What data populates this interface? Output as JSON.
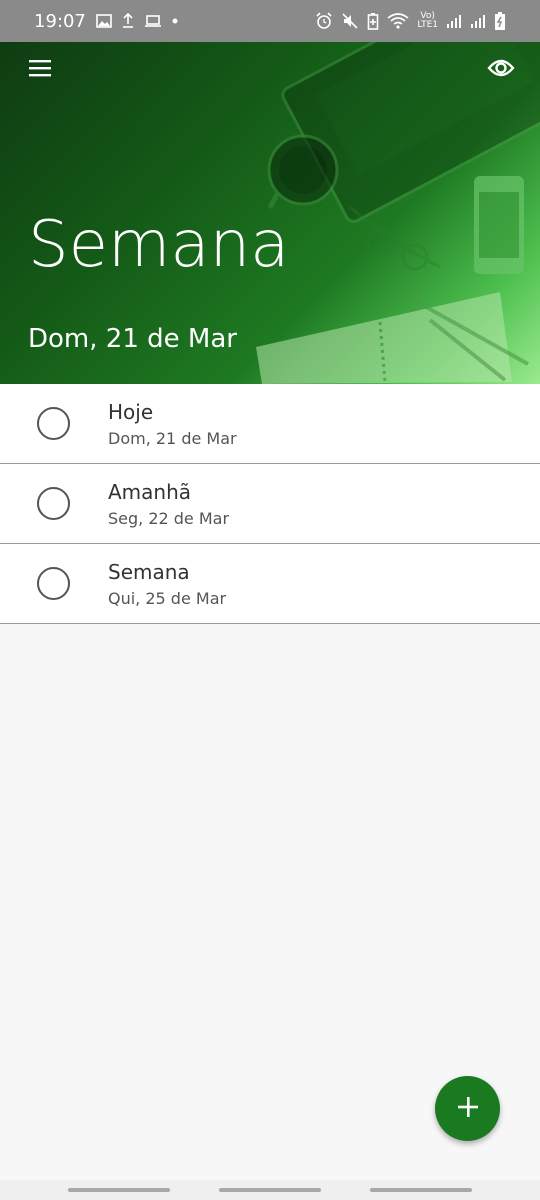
{
  "status_bar": {
    "time": "19:07",
    "network_top": "Vo)",
    "network_bottom": "LTE1",
    "icons": [
      "image-icon",
      "upload-icon",
      "laptop-icon",
      "dot-icon",
      "alarm-icon",
      "mute-icon",
      "battery-saver-icon",
      "wifi-icon",
      "signal-icon",
      "signal-icon",
      "battery-icon"
    ]
  },
  "header": {
    "title": "Semana",
    "date": "Dom, 21 de Mar",
    "menu_icon": "menu-icon",
    "view_icon": "eye-icon"
  },
  "tasks": [
    {
      "title": "Hoje",
      "subtitle": "Dom, 21 de Mar"
    },
    {
      "title": "Amanhã",
      "subtitle": "Seg, 22 de Mar"
    },
    {
      "title": "Semana",
      "subtitle": "Qui, 25 de Mar"
    }
  ],
  "fab": {
    "icon": "plus-icon"
  },
  "colors": {
    "accent": "#1a7a20",
    "header_dark": "#0f3c12",
    "header_light": "#9bea8e",
    "status_bar": "#8a8a8a"
  }
}
